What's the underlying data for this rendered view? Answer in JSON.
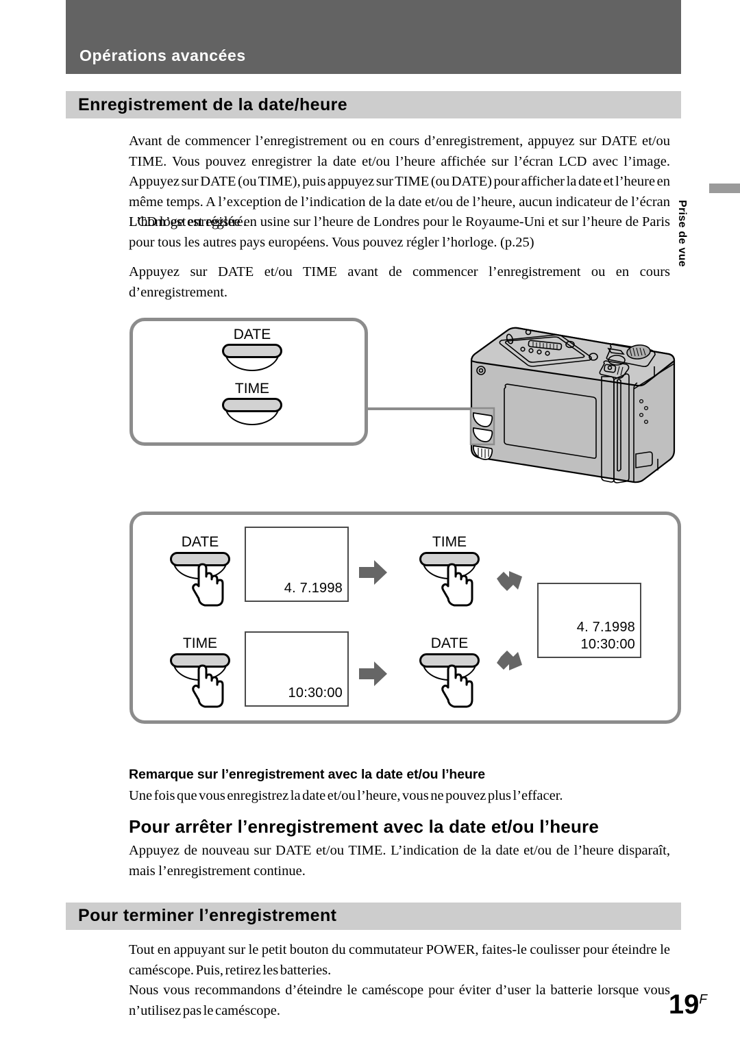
{
  "chapter": {
    "title": "Opérations avancées"
  },
  "section": {
    "title": "Enregistrement de la date/heure"
  },
  "side_tab": {
    "label": "Prise de vue"
  },
  "body": {
    "paragraph1": "Avant de commencer l’enregistrement ou en cours d’enregistrement, appuyez sur DATE et/ou TIME. Vous pouvez enregistrer la date et/ou l’heure affichée sur l’écran LCD avec l’image. Appuyez sur DATE (ou TIME), puis appuyez sur TIME (ou DATE) pour afficher la date et l’heure en même temps. A l’exception de l’indication de la date et/ou de l’heure, aucun indicateur de l’écran LCD n’est enregistré.",
    "paragraph2": "L’horloge est réglée en usine sur l’heure de Londres pour le Royaume-Uni et sur l’heure de Paris pour tous les autres pays européens. Vous pouvez régler l’horloge. (p.25)",
    "paragraph3": "Appuyez sur DATE et/ou TIME avant de commencer l’enregistrement ou en cours d’enregistrement."
  },
  "callout": {
    "date_label": "DATE",
    "time_label": "TIME"
  },
  "flow": {
    "step1": {
      "button": "DATE",
      "screen": "4. 7.1998"
    },
    "step2": {
      "button": "TIME",
      "screen": "10:30:00"
    },
    "step3": {
      "button": "TIME"
    },
    "step4": {
      "button": "DATE"
    },
    "result": {
      "line1": "4. 7.1998",
      "line2": "10:30:00"
    }
  },
  "note": {
    "heading": "Remarque sur l’enregistrement avec la date et/ou l’heure",
    "text": "Une fois que vous enregistrez la date et/ou l’heure, vous ne pouvez plus l’effacer."
  },
  "stop_section": {
    "heading": "Pour arrêter l’enregistrement avec la date et/ou l’heure",
    "text": "Appuyez de nouveau sur DATE et/ou TIME. L’indication de la date et/ou de l’heure disparaît, mais l’enregistrement continue."
  },
  "end_section": {
    "title": "Pour terminer l’enregistrement",
    "paragraph1": "Tout en appuyant sur le petit bouton du commutateur POWER, faites-le coulisser pour éteindre le caméscope. Puis, retirez les batteries.",
    "paragraph2": "Nous vous recommandons d’éteindre le caméscope pour éviter d’user la batterie lorsque vous n’utilisez pas le caméscope."
  },
  "footer": {
    "page_number": "19",
    "page_suffix": "F"
  },
  "colors": {
    "chapter_bar": "#636363",
    "section_bar": "#cdcdcd",
    "diagram_border": "#8c8c8c",
    "arrow": "#666666",
    "button_cap": "#d2d2d2"
  }
}
